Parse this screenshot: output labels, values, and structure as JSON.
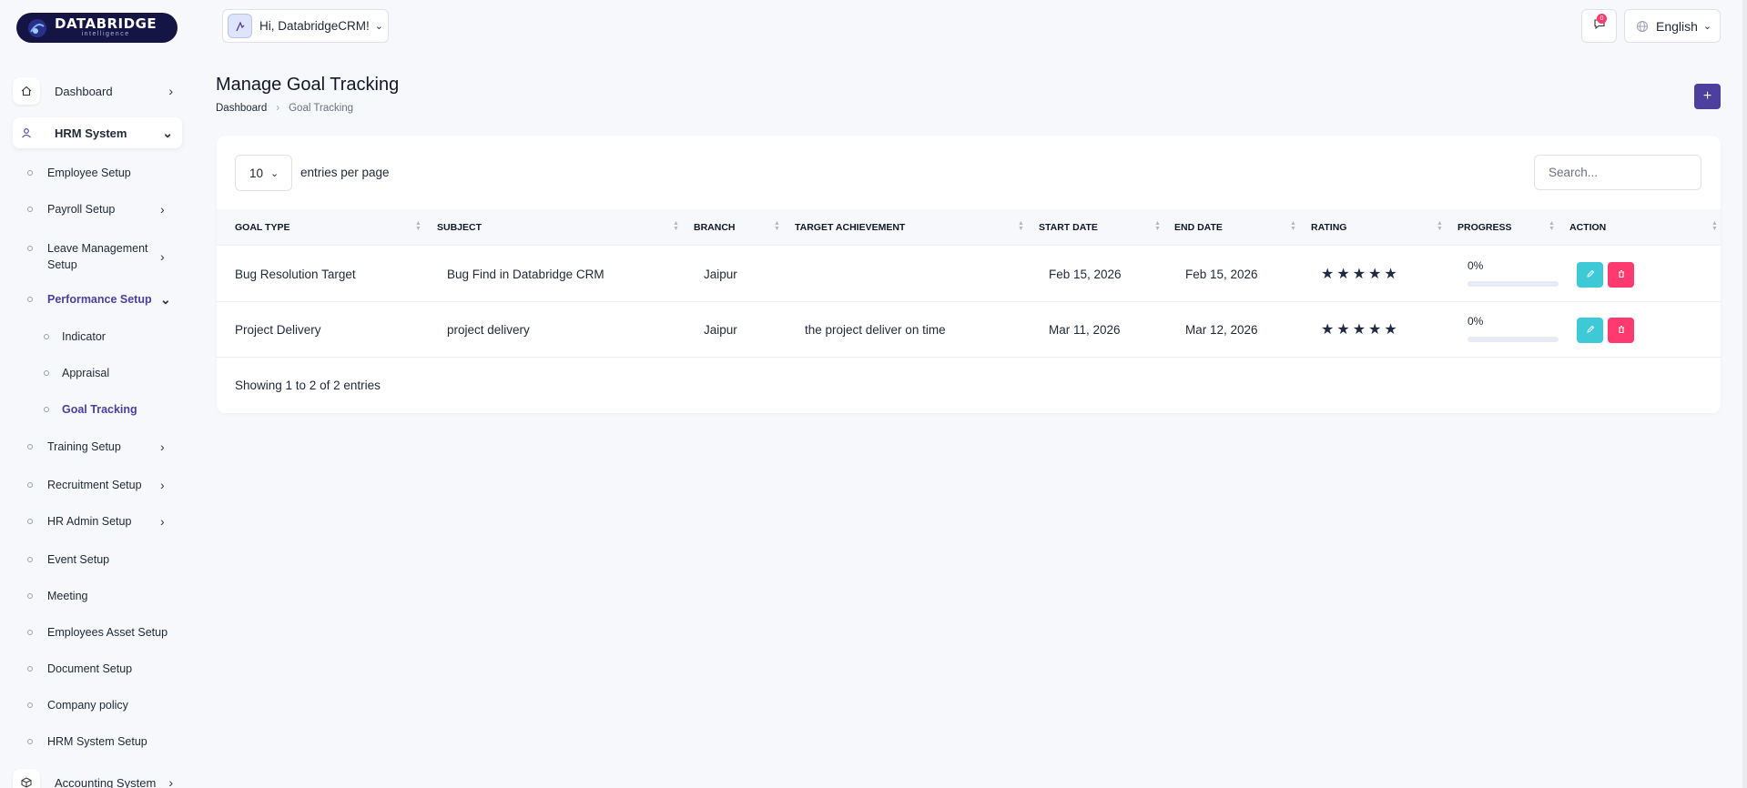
{
  "brand": {
    "title": "DATABRIDGE",
    "subtitle": "intelligence"
  },
  "sidebar": {
    "dashboard": "Dashboard",
    "hrm": "HRM System",
    "subs": {
      "employee_setup": "Employee Setup",
      "payroll_setup": "Payroll Setup",
      "leave_line1": "Leave Management",
      "leave_line2": "Setup",
      "performance_setup": "Performance Setup",
      "indicator": "Indicator",
      "appraisal": "Appraisal",
      "goal_tracking": "Goal Tracking",
      "training_setup": "Training Setup",
      "recruitment_setup": "Recruitment Setup",
      "hr_admin_setup": "HR Admin Setup",
      "event_setup": "Event Setup",
      "meeting": "Meeting",
      "employees_asset_setup": "Employees Asset Setup",
      "document_setup": "Document Setup",
      "company_policy": "Company policy",
      "hrm_system_setup": "HRM System Setup"
    },
    "accounting": "Accounting System"
  },
  "header": {
    "greeting": "Hi, DatabridgeCRM!",
    "notification_count": "0",
    "language": "English"
  },
  "page": {
    "title": "Manage Goal Tracking",
    "breadcrumb_home": "Dashboard",
    "breadcrumb_current": "Goal Tracking",
    "add_label": "+"
  },
  "table": {
    "per_page_value": "10",
    "per_page_label": "entries per page",
    "search_placeholder": "Search...",
    "columns": {
      "goal_type": "GOAL TYPE",
      "subject": "SUBJECT",
      "branch": "BRANCH",
      "target": "TARGET ACHIEVEMENT",
      "start": "START DATE",
      "end": "END DATE",
      "rating": "RATING",
      "progress": "PROGRESS",
      "action": "ACTION"
    },
    "rows": [
      {
        "goal_type": "Bug Resolution Target",
        "subject": "Bug Find in Databridge CRM",
        "branch": "Jaipur",
        "target": "",
        "start": "Feb 15, 2026",
        "end": "Feb 15, 2026",
        "rating": 5,
        "progress_label": "0%",
        "progress": 0
      },
      {
        "goal_type": "Project Delivery",
        "subject": "project delivery",
        "branch": "Jaipur",
        "target": "the project deliver on time",
        "start": "Mar 11, 2026",
        "end": "Mar 12, 2026",
        "rating": 5,
        "progress_label": "0%",
        "progress": 0
      }
    ],
    "showing": "Showing 1 to 2 of 2 entries"
  },
  "colors": {
    "accent": "#4c3f9e",
    "edit": "#3ec9d6",
    "delete": "#ff3a6e",
    "brand_bg": "#141545"
  }
}
